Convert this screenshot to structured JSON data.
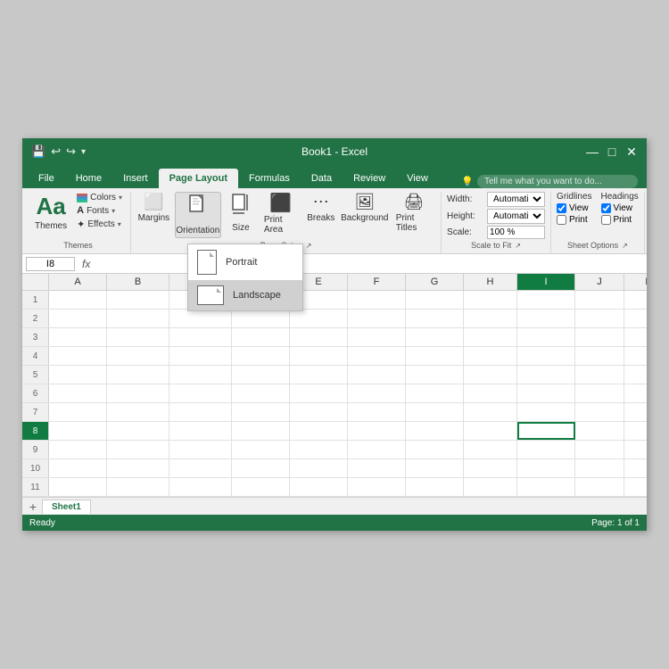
{
  "titleBar": {
    "title": "Book1 - Excel",
    "saveIcon": "💾",
    "undoLabel": "↩",
    "redoLabel": "↪"
  },
  "ribbonTabs": {
    "tabs": [
      "File",
      "Home",
      "Insert",
      "Page Layout",
      "Formulas",
      "Data",
      "Review",
      "View"
    ],
    "activeTab": "Page Layout",
    "tellMePlaceholder": "Tell me what you want to do..."
  },
  "ribbonGroups": {
    "themes": {
      "label": "Themes",
      "themeBtn": "Aa",
      "colorsBtn": "Colors",
      "fontsBtn": "Fonts",
      "effectsBtn": "Effects"
    },
    "pageSetup": {
      "label": "Page Setup",
      "marginsLabel": "Margins",
      "orientationLabel": "Orientation",
      "sizeLabel": "Size",
      "printAreaLabel": "Print Area",
      "breaksLabel": "Breaks",
      "backgroundLabel": "Background",
      "printTitlesLabel": "Print Titles"
    },
    "scaleToFit": {
      "label": "Scale to Fit",
      "widthLabel": "Width:",
      "widthValue": "Automatic",
      "heightLabel": "Height:",
      "heightValue": "Automatic",
      "scaleLabel": "Scale:",
      "scaleValue": "100 %"
    },
    "sheetOptions": {
      "label": "Sheet Options",
      "gridlinesLabel": "Gridlines",
      "headingsLabel": "Headings",
      "printLabel": "Print",
      "viewLabel": "View"
    }
  },
  "orientationDropdown": {
    "items": [
      {
        "label": "Portrait",
        "type": "portrait"
      },
      {
        "label": "Landscape",
        "type": "landscape",
        "selected": true
      }
    ]
  },
  "formulaBar": {
    "nameBox": "I8",
    "fx": "fx"
  },
  "columns": [
    "A",
    "B",
    "C",
    "D",
    "E",
    "F",
    "G",
    "H",
    "I",
    "J",
    "K"
  ],
  "rows": [
    "1",
    "2",
    "3",
    "4",
    "5",
    "6",
    "7",
    "8",
    "9",
    "10",
    "11"
  ],
  "activeCell": "I8",
  "sheetTabs": {
    "tabs": [
      "Sheet1"
    ],
    "activeTab": "Sheet1"
  },
  "statusBar": {
    "readyLabel": "Ready",
    "pageInfo": "Page: 1 of 1"
  }
}
